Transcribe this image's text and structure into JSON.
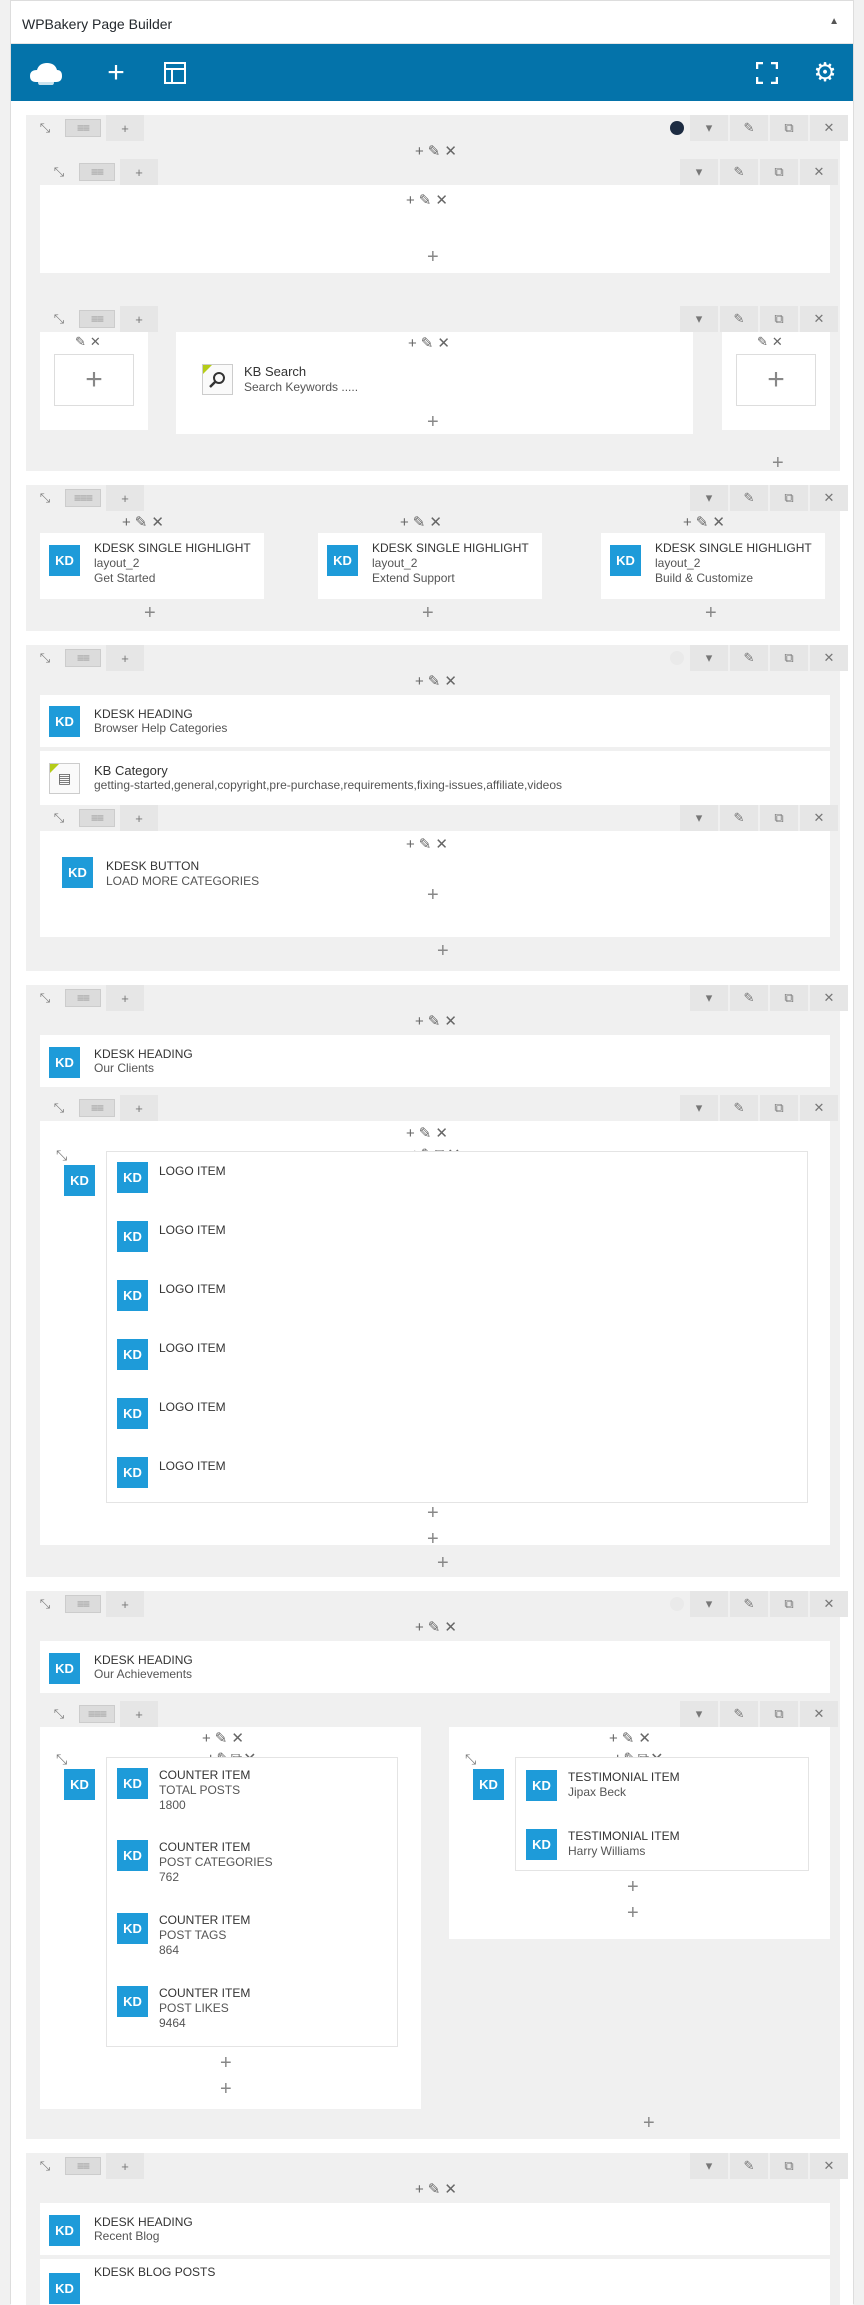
{
  "title": "WPBakery Page Builder",
  "add": "+",
  "edit": "✎",
  "del": "✕",
  "clone": "⧉",
  "caret": "▾",
  "kd": "KD",
  "nested_controls": "+✎⧉✕",
  "colors": {
    "topbar": "#0473aa",
    "kd_badge": "#1e9bd9",
    "row_bg": "#f0f0f0"
  },
  "icons": [
    "cloud-icon",
    "plus-icon",
    "layout-icon",
    "fullscreen-icon",
    "gear-icon",
    "expand-icon",
    "drag-handle-icon",
    "pencil-icon",
    "close-icon",
    "clone-icon",
    "chevron-down-icon",
    "search-icon",
    "grid-icon"
  ],
  "search": {
    "name": "KB Search",
    "sub": "Search Keywords ....."
  },
  "highlights": [
    {
      "name": "KDESK SINGLE HIGHLIGHT",
      "layout": "layout_2",
      "sub": "Get Started"
    },
    {
      "name": "KDESK SINGLE HIGHLIGHT",
      "layout": "layout_2",
      "sub": "Extend Support"
    },
    {
      "name": "KDESK SINGLE HIGHLIGHT",
      "layout": "layout_2",
      "sub": "Build & Customize"
    }
  ],
  "help_heading": {
    "name": "KDESK HEADING",
    "sub": "Browser Help Categories"
  },
  "kb_category": {
    "name": "KB Category",
    "sub": "getting-started,general,copyright,pre-purchase,requirements,fixing-issues,affiliate,videos"
  },
  "button": {
    "name": "KDESK BUTTON",
    "sub": "LOAD MORE CATEGORIES"
  },
  "clients_heading": {
    "name": "KDESK HEADING",
    "sub": "Our Clients"
  },
  "logo_label": "LOGO ITEM",
  "achievements_heading": {
    "name": "KDESK HEADING",
    "sub": "Our Achievements"
  },
  "counters": [
    {
      "name": "COUNTER ITEM",
      "label": "TOTAL POSTS",
      "value": "1800"
    },
    {
      "name": "COUNTER ITEM",
      "label": "POST CATEGORIES",
      "value": "762"
    },
    {
      "name": "COUNTER ITEM",
      "label": "POST TAGS",
      "value": "864"
    },
    {
      "name": "COUNTER ITEM",
      "label": "POST LIKES",
      "value": "9464"
    }
  ],
  "testimonials": [
    {
      "name": "TESTIMONIAL ITEM",
      "sub": "Jipax Beck"
    },
    {
      "name": "TESTIMONIAL ITEM",
      "sub": "Harry Williams"
    }
  ],
  "blog_heading": {
    "name": "KDESK HEADING",
    "sub": "Recent Blog"
  },
  "blog_posts": {
    "name": "KDESK BLOG POSTS"
  }
}
